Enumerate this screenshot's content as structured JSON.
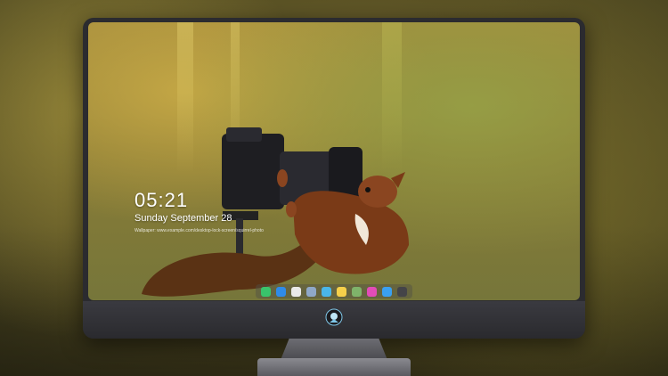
{
  "lock_screen": {
    "time": "05:21",
    "date": "Sunday September 28",
    "footer_text": "Wallpaper: www.example.com/desktop-lock-screen/squirrel-photo"
  },
  "dock": {
    "apps": [
      {
        "name": "messages-icon",
        "color": "#39c46b"
      },
      {
        "name": "finder-icon",
        "color": "#2f8be8"
      },
      {
        "name": "safari-icon",
        "color": "#e9e9e9"
      },
      {
        "name": "preview-icon",
        "color": "#8fa8c8"
      },
      {
        "name": "clips-icon",
        "color": "#4ab6e8"
      },
      {
        "name": "notes-icon",
        "color": "#f5d04a"
      },
      {
        "name": "photos-icon",
        "color": "#7fb36a"
      },
      {
        "name": "itunes-icon",
        "color": "#e24cb8"
      },
      {
        "name": "app-store-icon",
        "color": "#3aa0f0"
      },
      {
        "name": "terminal-icon",
        "color": "#444448"
      }
    ]
  },
  "colors": {
    "monitor_frame": "#2b2b2f",
    "squirrel": "#7a3a17",
    "camera": "#1e1e22"
  }
}
